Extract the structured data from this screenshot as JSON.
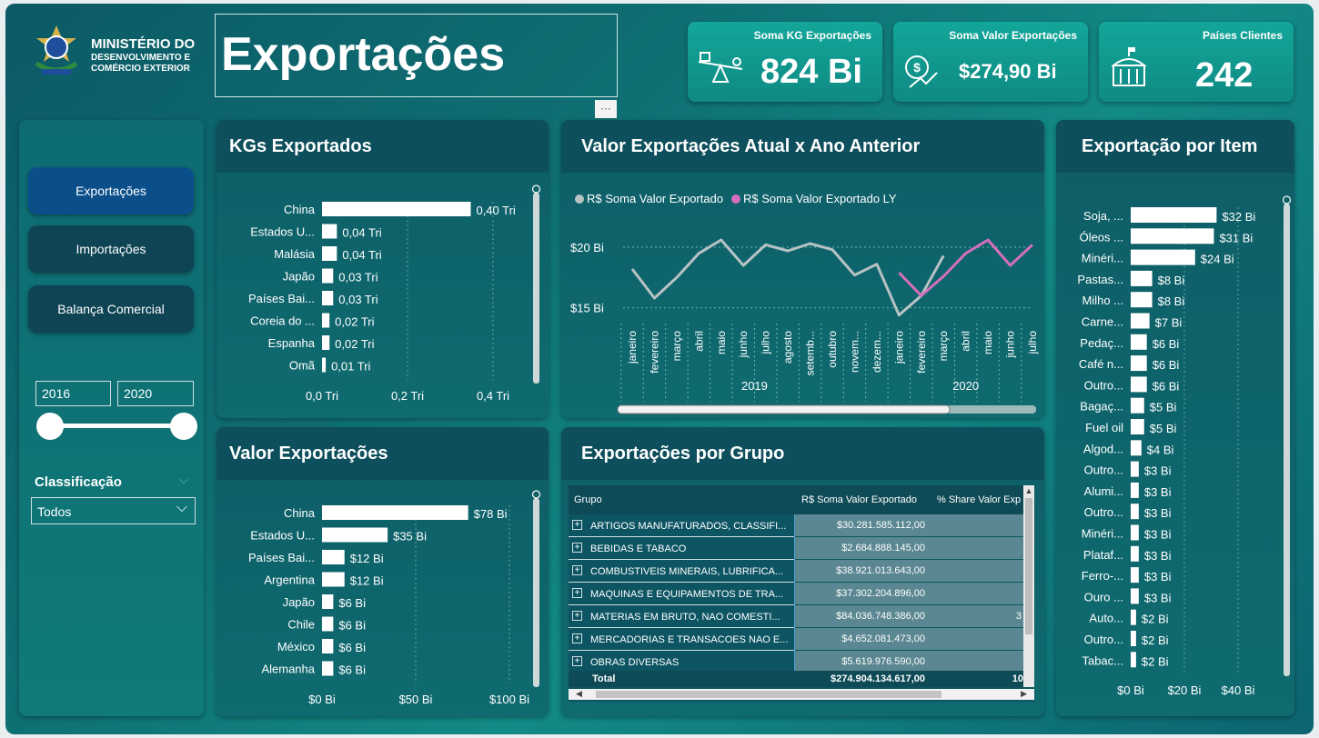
{
  "header": {
    "org_line1": "MINISTÉRIO DO",
    "org_line2": "DESENVOLVIMENTO E",
    "org_line3": "COMÉRCIO EXTERIOR",
    "title": "Exportações",
    "more_label": "···"
  },
  "kpis": [
    {
      "title": "Soma KG Exportações",
      "value": "824 Bi",
      "icon": "seesaw-scale-icon"
    },
    {
      "title": "Soma Valor Exportações",
      "value": "$274,90 Bi",
      "icon": "money-growth-icon"
    },
    {
      "title": "Países Clientes",
      "value": "242",
      "icon": "government-building-icon"
    }
  ],
  "nav": {
    "exportacoes": "Exportações",
    "importacoes": "Importações",
    "balanca": "Balança Comercial"
  },
  "filters": {
    "year_from": "2016",
    "year_to": "2020",
    "classificacao_label": "Classificação",
    "classificacao_value": "Todos"
  },
  "panels": {
    "kgs": "KGs Exportados",
    "valor_atual": "Valor Exportações Atual x Ano Anterior",
    "por_item": "Exportação por Item",
    "valor_exp": "Valor Exportações",
    "por_grupo": "Exportações por Grupo"
  },
  "chart_data": [
    {
      "type": "bar",
      "orientation": "horizontal",
      "title": "KGs Exportados",
      "categories": [
        "China",
        "Estados U...",
        "Malásia",
        "Japão",
        "Países Bai...",
        "Coreia do ...",
        "Espanha",
        "Omã"
      ],
      "values": [
        0.4,
        0.04,
        0.04,
        0.03,
        0.03,
        0.02,
        0.02,
        0.01
      ],
      "labels": [
        "0,40 Tri",
        "0,04 Tri",
        "0,04 Tri",
        "0,03 Tri",
        "0,03 Tri",
        "0,02 Tri",
        "0,02 Tri",
        "0,01 Tri"
      ],
      "ticks": [
        "0,0 Tri",
        "0,2 Tri",
        "0,4 Tri"
      ],
      "xlim": [
        0,
        0.46
      ]
    },
    {
      "type": "line",
      "title": "Valor Exportações Atual x Ano Anterior",
      "legend": [
        "R$ Soma Valor Exportado",
        "R$ Soma Valor Exportado LY"
      ],
      "legend_colors": [
        "#b7c2c4",
        "#d46fc0"
      ],
      "x": [
        "janeiro",
        "fevereiro",
        "março",
        "abril",
        "maio",
        "junho",
        "julho",
        "agosto",
        "setemb...",
        "outubro",
        "novem...",
        "dezem...",
        "janeiro",
        "fevereiro",
        "março",
        "abril",
        "maio",
        "junho",
        "julho"
      ],
      "years": [
        "2019",
        "2020"
      ],
      "yticks": [
        "$20 Bi",
        "$15 Bi"
      ],
      "ylim": [
        14,
        21.5
      ],
      "series": [
        {
          "name": "R$ Soma Valor Exportado",
          "values": [
            18.2,
            15.8,
            17.5,
            19.5,
            20.6,
            18.5,
            20.2,
            19.7,
            20.3,
            19.8,
            17.7,
            18.6,
            14.4,
            16.0,
            19.3,
            null,
            null,
            null,
            null
          ]
        },
        {
          "name": "R$ Soma Valor Exportado LY",
          "values": [
            null,
            null,
            null,
            null,
            null,
            null,
            null,
            null,
            null,
            null,
            null,
            null,
            17.9,
            16.0,
            17.6,
            19.5,
            20.6,
            18.5,
            20.2
          ]
        }
      ]
    },
    {
      "type": "bar",
      "orientation": "horizontal",
      "title": "Exportação por Item",
      "categories": [
        "Soja, ...",
        "Óleos ...",
        "Minéri...",
        "Pastas...",
        "Milho ...",
        "Carne...",
        "Pedaç...",
        "Café n...",
        "Outro...",
        "Bagaç...",
        "Fuel oil",
        "Algod...",
        "Outro...",
        "Alumi...",
        "Outro...",
        "Minéri...",
        "Plataf...",
        "Ferro-...",
        "Ouro ...",
        "Auto...",
        "Outro...",
        "Tabac..."
      ],
      "values": [
        32,
        31,
        24,
        8,
        8,
        7,
        6,
        6,
        6,
        5,
        5,
        4,
        3,
        3,
        3,
        3,
        3,
        3,
        3,
        2,
        2,
        2
      ],
      "labels": [
        "$32 Bi",
        "$31 Bi",
        "$24 Bi",
        "$8 Bi",
        "$8 Bi",
        "$7 Bi",
        "$6 Bi",
        "$6 Bi",
        "$6 Bi",
        "$5 Bi",
        "$5 Bi",
        "$4 Bi",
        "$3 Bi",
        "$3 Bi",
        "$3 Bi",
        "$3 Bi",
        "$3 Bi",
        "$3 Bi",
        "$3 Bi",
        "$2 Bi",
        "$2 Bi",
        "$2 Bi"
      ],
      "ticks": [
        "$0 Bi",
        "$20 Bi",
        "$40 Bi"
      ],
      "xlim": [
        0,
        40
      ]
    },
    {
      "type": "bar",
      "orientation": "horizontal",
      "title": "Valor Exportações",
      "categories": [
        "China",
        "Estados U...",
        "Países Bai...",
        "Argentina",
        "Japão",
        "Chile",
        "México",
        "Alemanha"
      ],
      "values": [
        78,
        35,
        12,
        12,
        6,
        6,
        6,
        6
      ],
      "labels": [
        "$78 Bi",
        "$35 Bi",
        "$12 Bi",
        "$12 Bi",
        "$6 Bi",
        "$6 Bi",
        "$6 Bi",
        "$6 Bi"
      ],
      "ticks": [
        "$0 Bi",
        "$50 Bi",
        "$100 Bi"
      ],
      "xlim": [
        0,
        100
      ]
    },
    {
      "type": "table",
      "title": "Exportações por Grupo",
      "columns": [
        "Grupo",
        "R$ Soma Valor Exportado",
        "% Share Valor Exp"
      ],
      "rows": [
        [
          "ARTIGOS MANUFATURADOS, CLASSIFI...",
          "$30.281.585.112,00",
          ""
        ],
        [
          "BEBIDAS E TABACO",
          "$2.684.888.145,00",
          ""
        ],
        [
          "COMBUSTIVEIS MINERAIS, LUBRIFICA...",
          "$38.921.013.643,00",
          ""
        ],
        [
          "MAQUINAS E EQUIPAMENTOS DE TRA...",
          "$37.302.204.896,00",
          ""
        ],
        [
          "MATERIAS EM BRUTO, NAO COMESTI...",
          "$84.036.748.386,00",
          "3"
        ],
        [
          "MERCADORIAS E TRANSACOES NAO E...",
          "$4.652.081.473,00",
          ""
        ],
        [
          "OBRAS DIVERSAS",
          "$5.619.976.590,00",
          ""
        ]
      ],
      "total": [
        "Total",
        "$274.904.134.617,00",
        "10"
      ]
    }
  ]
}
